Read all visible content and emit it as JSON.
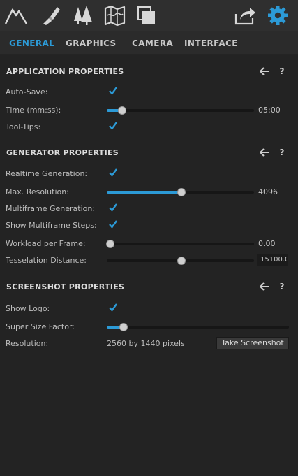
{
  "toolbar": {
    "icons": [
      "mountain-icon",
      "brush-icon",
      "trees-icon",
      "map-icon",
      "layers-icon",
      "share-icon",
      "gear-icon"
    ],
    "accent": "#2c9ad6"
  },
  "tabs": [
    {
      "label": "GENERAL",
      "active": true
    },
    {
      "label": "GRAPHICS",
      "active": false
    },
    {
      "label": "CAMERA",
      "active": false
    },
    {
      "label": "INTERFACE",
      "active": false
    }
  ],
  "app": {
    "title": "APPLICATION PROPERTIES",
    "help": "?",
    "autosave": {
      "label": "Auto-Save:",
      "checked": true
    },
    "time": {
      "label": "Time (mm:ss):",
      "value": "05:00",
      "level": 0.1
    },
    "tooltips": {
      "label": "Tool-Tips:",
      "checked": true
    }
  },
  "gen": {
    "title": "GENERATOR PROPERTIES",
    "help": "?",
    "realtime": {
      "label": "Realtime Generation:",
      "checked": true
    },
    "maxres": {
      "label": "Max. Resolution:",
      "value": "4096",
      "level": 0.5
    },
    "multiframe": {
      "label": "Multiframe Generation:",
      "checked": true
    },
    "showsteps": {
      "label": "Show Multiframe Steps:",
      "checked": true
    },
    "workload": {
      "label": "Workload per Frame:",
      "value": "0.00",
      "level": 0.02
    },
    "tessel": {
      "label": "Tesselation Distance:",
      "value": "15100.0",
      "level": 0.5
    }
  },
  "shot": {
    "title": "SCREENSHOT PROPERTIES",
    "help": "?",
    "logo": {
      "label": "Show Logo:",
      "checked": true
    },
    "supersize": {
      "label": "Super Size Factor:",
      "level": 0.09
    },
    "resolution": {
      "label": "Resolution:",
      "value": "2560 by 1440 pixels"
    },
    "take_label": "Take Screenshot"
  }
}
